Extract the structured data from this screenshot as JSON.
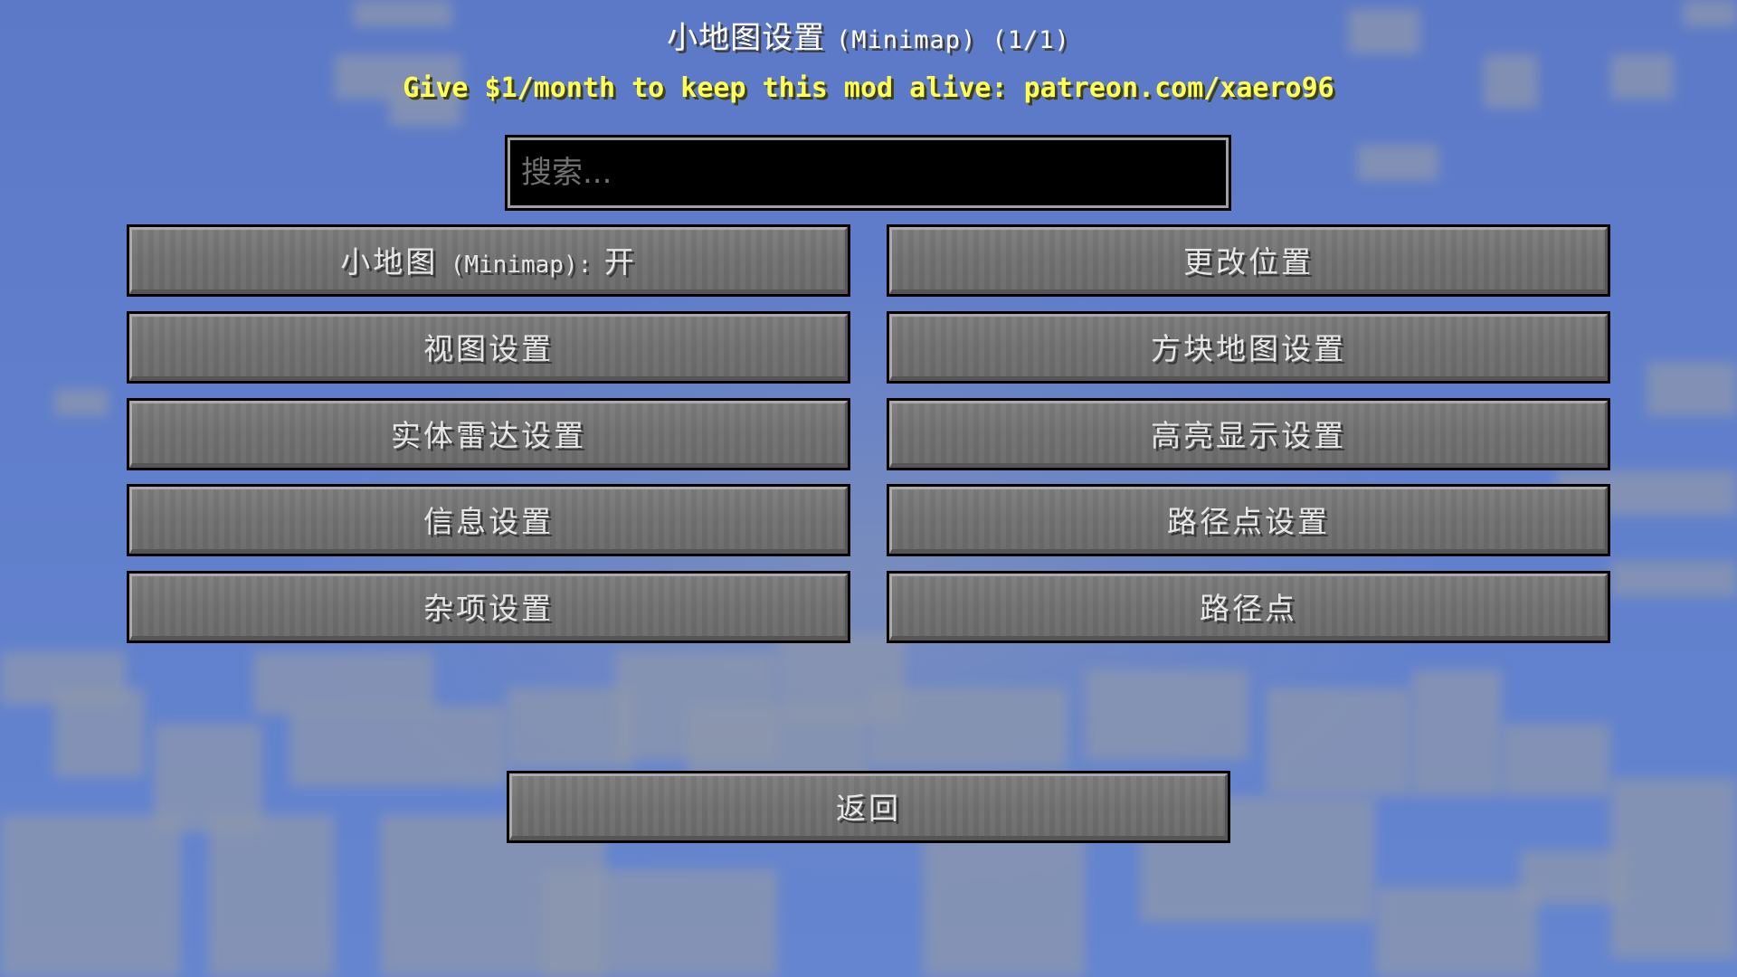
{
  "screen": {
    "title": "小地图设置",
    "title_suffix": "(Minimap) (1/1)",
    "patreon_text": "Give $1/month to keep this mod alive: patreon.com/xaero96"
  },
  "search": {
    "placeholder": "搜索...",
    "value": ""
  },
  "buttons": {
    "minimap_toggle": {
      "label_prefix": "小地图",
      "label_mono": "(Minimap):",
      "label_value": "开"
    },
    "change_position": "更改位置",
    "view_settings": "视图设置",
    "block_map_settings": "方块地图设置",
    "entity_radar_settings": "实体雷达设置",
    "highlight_settings": "高亮显示设置",
    "info_settings": "信息设置",
    "waypoint_settings": "路径点设置",
    "misc_settings": "杂项设置",
    "waypoints": "路径点",
    "back": "返回"
  },
  "colors": {
    "sky_blue": "#5f7ccb",
    "patreon_yellow": "#ffff55",
    "button_gray": "#6f6f6f",
    "text_white": "#e6e6e6"
  }
}
